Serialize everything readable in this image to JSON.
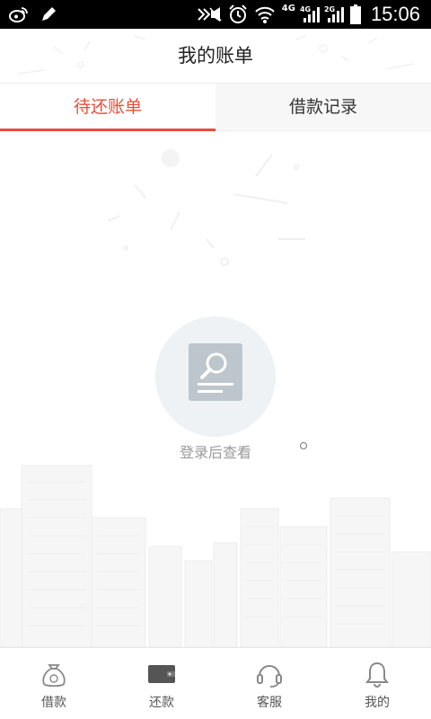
{
  "status_bar": {
    "time": "15:06",
    "network_1": "4G",
    "network_2": "4G",
    "network_3": "2G",
    "left_icons": [
      "weibo-icon",
      "pencil-icon"
    ],
    "right_icons": [
      "mute-icon",
      "alarm-icon",
      "wifi-icon",
      "signal-icon",
      "signal-icon",
      "battery-icon"
    ]
  },
  "header": {
    "title": "我的账单"
  },
  "tabs": [
    {
      "label": "待还账单",
      "active": true
    },
    {
      "label": "借款记录",
      "active": false
    }
  ],
  "empty_state": {
    "icon": "search-document-icon",
    "message": "登录后查看"
  },
  "bottom_nav": [
    {
      "label": "借款",
      "icon": "money-bag-icon"
    },
    {
      "label": "还款",
      "icon": "wallet-icon"
    },
    {
      "label": "客服",
      "icon": "headset-icon"
    },
    {
      "label": "我的",
      "icon": "bell-icon"
    }
  ],
  "colors": {
    "accent": "#e84d3d",
    "status_bar": "#000000",
    "empty_circle": "#eef2f4",
    "empty_doc": "#bdc6cc"
  }
}
